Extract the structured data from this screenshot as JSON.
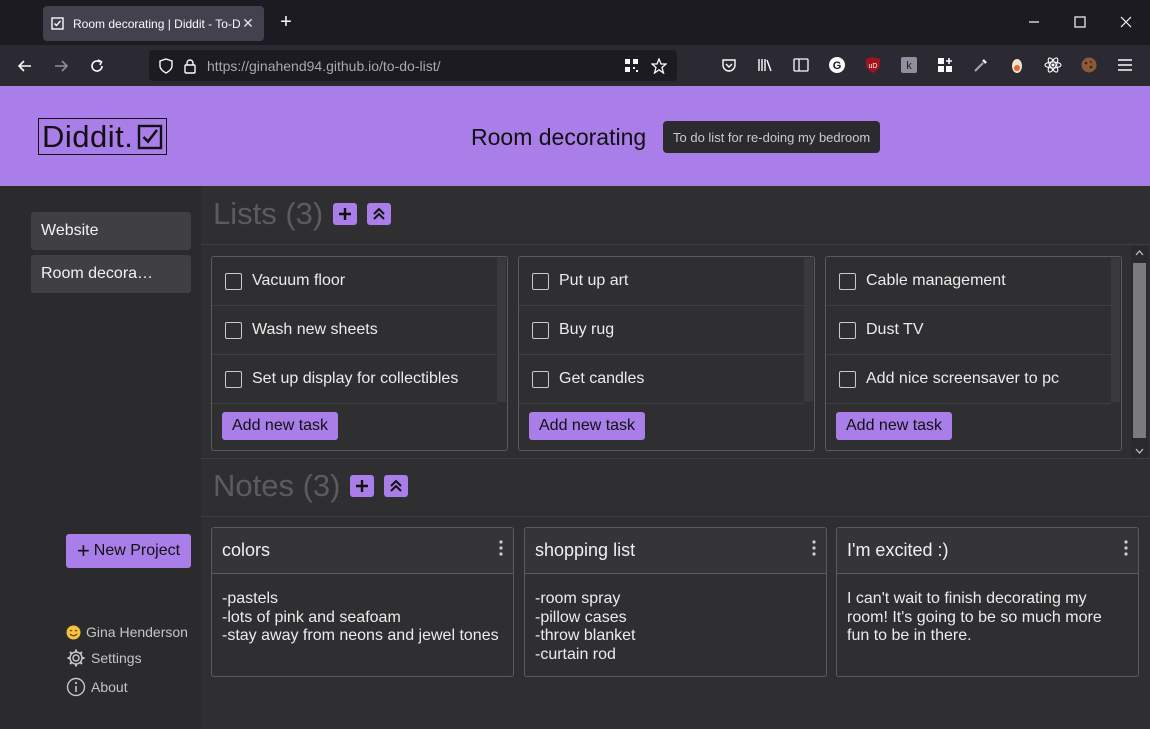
{
  "browser": {
    "tab_title": "Room decorating | Diddit - To-D",
    "url_host": "https://ginahend94.github.io",
    "url_path": "/to-do-list/"
  },
  "header": {
    "logo_text": "Diddit.",
    "project_title": "Room decorating",
    "project_description": "To do list for re-doing my bedroom"
  },
  "sidebar": {
    "projects": [
      "Website",
      "Room decora…"
    ],
    "new_project_label": "New Project",
    "user_name": "Gina Henderson",
    "settings_label": "Settings",
    "about_label": "About"
  },
  "lists": {
    "heading": "Lists (3)",
    "add_task_label": "Add new task",
    "items": [
      {
        "tasks": [
          "Vacuum floor",
          "Wash new sheets",
          "Set up display for collectibles"
        ]
      },
      {
        "tasks": [
          "Put up art",
          "Buy rug",
          "Get candles"
        ]
      },
      {
        "tasks": [
          "Cable management",
          "Dust TV",
          "Add nice screensaver to pc"
        ]
      }
    ]
  },
  "notes": {
    "heading": "Notes (3)",
    "items": [
      {
        "title": "colors",
        "lines": [
          "-pastels",
          "-lots of pink and seafoam",
          "-stay away from neons and jewel tones"
        ]
      },
      {
        "title": "shopping list",
        "lines": [
          "-room spray",
          "-pillow cases",
          "-throw blanket",
          "-curtain rod"
        ]
      },
      {
        "title": "I'm excited :)",
        "lines": [
          "I can't wait to finish decorating my",
          "room! It's going to be so much more",
          "fun to be in there."
        ]
      }
    ]
  },
  "colors": {
    "accent": "#a97ee8",
    "background": "#2f2e31",
    "sidebar": "#2b2a2c"
  }
}
